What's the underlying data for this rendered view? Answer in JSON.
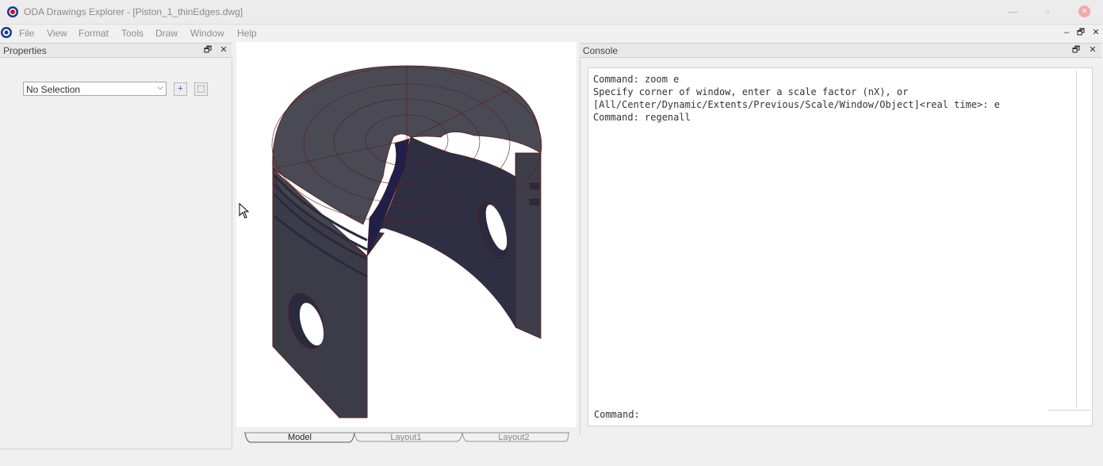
{
  "window": {
    "title": "ODA Drawings Explorer - [Piston_1_thinEdges.dwg]",
    "minimize": "—",
    "restore": "▫",
    "close": "×"
  },
  "menu": {
    "items": [
      "File",
      "View",
      "Format",
      "Tools",
      "Draw",
      "Window",
      "Help"
    ],
    "mdi_minimize": "–",
    "mdi_restore": "🗗",
    "mdi_close": "✕"
  },
  "properties": {
    "title": "Properties",
    "float_btn": "🗗",
    "close_btn": "✕",
    "selection": "No Selection",
    "add_btn": "+",
    "select_btn": "⬚"
  },
  "viewport": {
    "tabs": [
      "Model",
      "Layout1",
      "Layout2"
    ],
    "active_tab": "Model"
  },
  "console": {
    "title": "Console",
    "float_btn": "🗗",
    "close_btn": "✕",
    "lines": [
      "Command: zoom e",
      "Specify corner of window, enter a scale factor (nX), or",
      "[All/Center/Dynamic/Extents/Previous/Scale/Window/Object]<real time>: e",
      "Command: regenall"
    ],
    "prompt": "Command:"
  },
  "colors": {
    "piston_face": "#45454f",
    "piston_dark": "#2a2a3e",
    "piston_inner": "#1f1f4a",
    "edge": "#5a1a1a",
    "logo_blue": "#1a3a8a",
    "logo_red": "#c8102e"
  }
}
